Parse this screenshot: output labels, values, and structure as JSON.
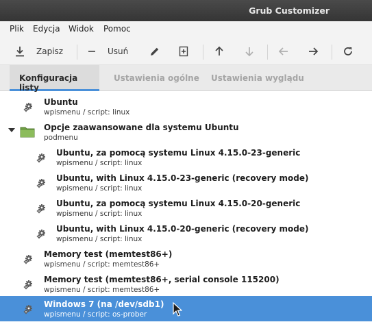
{
  "window": {
    "title": "Grub Customizer"
  },
  "menu": [
    "Plik",
    "Edycja",
    "Widok",
    "Pomoc"
  ],
  "toolbar": {
    "save_label": "Zapisz",
    "remove_label": "Usuń",
    "save_icon": "download-icon",
    "remove_icon": "minus-icon",
    "edit_icon": "pencil-icon",
    "add_entry_icon": "add-entry-icon",
    "move_up_icon": "arrow-up-icon",
    "move_down_icon": "arrow-down-icon",
    "move_left_icon": "arrow-left-icon",
    "move_right_icon": "arrow-right-icon",
    "refresh_icon": "refresh-icon"
  },
  "tabs": [
    {
      "label": "Konfiguracja listy",
      "active": true
    },
    {
      "label": "Ustawienia ogólne",
      "active": false
    },
    {
      "label": "Ustawienia wyglądu",
      "active": false
    }
  ],
  "entries": [
    {
      "title": "Ubuntu",
      "subtitle": "wpismenu / script: linux",
      "icon": "gear-icon"
    },
    {
      "title": "Opcje zaawansowane dla systemu Ubuntu",
      "subtitle": "podmenu",
      "icon": "folder-icon",
      "expanded": true
    },
    {
      "title": "Ubuntu, za pomocą systemu Linux 4.15.0-23-generic",
      "subtitle": "wpismenu / script: linux",
      "icon": "gear-icon"
    },
    {
      "title": "Ubuntu, with Linux 4.15.0-23-generic (recovery mode)",
      "subtitle": "wpismenu / script: linux",
      "icon": "gear-icon"
    },
    {
      "title": "Ubuntu, za pomocą systemu Linux 4.15.0-20-generic",
      "subtitle": "wpismenu / script: linux",
      "icon": "gear-icon"
    },
    {
      "title": "Ubuntu, with Linux 4.15.0-20-generic (recovery mode)",
      "subtitle": "wpismenu / script: linux",
      "icon": "gear-icon"
    },
    {
      "title": "Memory test (memtest86+)",
      "subtitle": "wpismenu / script: memtest86+",
      "icon": "gear-icon"
    },
    {
      "title": "Memory test (memtest86+, serial console 115200)",
      "subtitle": "wpismenu / script: memtest86+",
      "icon": "gear-icon"
    },
    {
      "title": "Windows 7 (na /dev/sdb1)",
      "subtitle": "wpismenu / script: os-prober",
      "icon": "gear-icon",
      "selected": true
    }
  ],
  "colors": {
    "selection": "#4a90d9",
    "titlebar": "#3c3c3c",
    "folder": "#7aab4f"
  }
}
